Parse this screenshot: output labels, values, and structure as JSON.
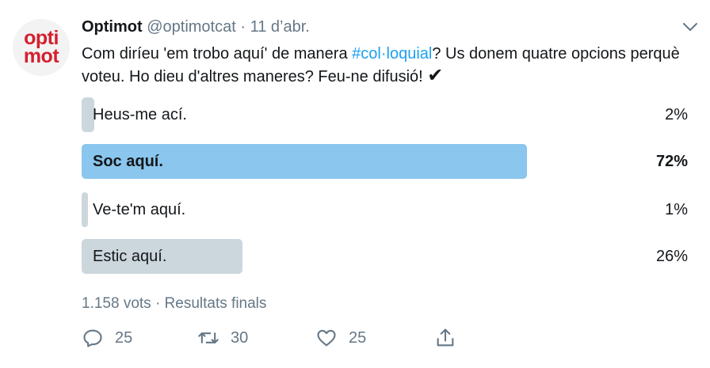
{
  "tweet": {
    "avatar_text_line1": "opti",
    "avatar_text_line2": "mot",
    "author_name": "Optimot",
    "handle": "@optimotcat",
    "separator": "·",
    "date": "11 d’abr.",
    "text_before": "Com diríeu 'em trobo aquí' de manera ",
    "hashtag": "#col·loquial",
    "text_after": "? Us donem quatre opcions perquè voteu. Ho dieu d'altres maneres? Feu-ne difusió! ",
    "check_emoji": "✔"
  },
  "poll": {
    "options": [
      {
        "label": "Heus-me ací.",
        "percent_text": "2%",
        "percent": 2,
        "winner": false
      },
      {
        "label": "Soc aquí.",
        "percent_text": "72%",
        "percent": 72,
        "winner": true
      },
      {
        "label": "Ve-te'm aquí.",
        "percent_text": "1%",
        "percent": 1,
        "winner": false
      },
      {
        "label": "Estic aquí.",
        "percent_text": "26%",
        "percent": 26,
        "winner": false
      }
    ],
    "summary": "1.158 vots · Resultats finals"
  },
  "actions": {
    "reply_count": "25",
    "retweet_count": "30",
    "like_count": "25",
    "reply_icon": "reply-icon",
    "retweet_icon": "retweet-icon",
    "like_icon": "heart-icon",
    "share_icon": "share-icon"
  },
  "colors": {
    "accent": "#1da1f2",
    "poll_bar": "#ccd6dd",
    "poll_bar_winner": "#8ac6ed",
    "muted": "#657786",
    "brand_red": "#d4202e"
  }
}
